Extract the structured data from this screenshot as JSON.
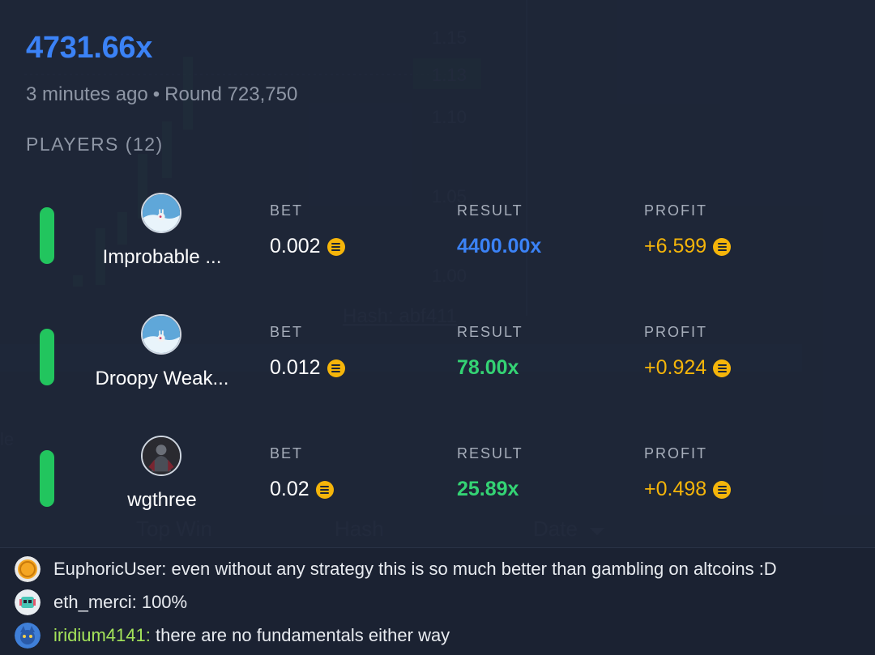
{
  "round": {
    "multiplier": "4731.66x",
    "time_ago": "3 minutes ago",
    "separator": "•",
    "round_label": "Round 723,750"
  },
  "players_heading": "PLAYERS (12)",
  "columns": {
    "bet": "BET",
    "result": "RESULT",
    "profit": "PROFIT"
  },
  "players": [
    {
      "name": "Improbable ...",
      "bet": "0.002",
      "result": "4400.00x",
      "profit": "+6.599",
      "avatar_icon": "bunny-snow-avatar-icon",
      "result_color": "#3b82f6"
    },
    {
      "name": "Droopy Weak...",
      "bet": "0.012",
      "result": "78.00x",
      "profit": "+0.924",
      "avatar_icon": "bunny-snow-avatar-icon",
      "result_color": "#34d374"
    },
    {
      "name": "wgthree",
      "bet": "0.02",
      "result": "25.89x",
      "profit": "+0.498",
      "avatar_icon": "dark-knight-avatar-icon",
      "result_color": "#34d374"
    }
  ],
  "background": {
    "price_ticks": [
      "1.15",
      "1.13",
      "1.10",
      "1.05",
      "1.00"
    ],
    "hash_text": "Hash: abf411",
    "table_headers": [
      "Top Win",
      "Hash",
      "Date"
    ],
    "side_fragment": "le"
  },
  "chat": [
    {
      "user": "EuphoricUser",
      "separator": ":",
      "message": " even without any strategy this is so much better than gambling on altcoins :D",
      "avatar_icon": "gold-coin-avatar-icon"
    },
    {
      "user": "eth_merci",
      "separator": ":",
      "message": " 100%",
      "avatar_icon": "robot-avatar-icon"
    },
    {
      "user": "iridium4141",
      "separator": ":",
      "message": " there are no fundamentals either way",
      "avatar_icon": "blue-creature-avatar-icon"
    }
  ],
  "colors": {
    "accent_blue": "#3b82f6",
    "win_green": "#34d374",
    "profit_gold": "#f5b50a",
    "status_green": "#22c55e"
  }
}
